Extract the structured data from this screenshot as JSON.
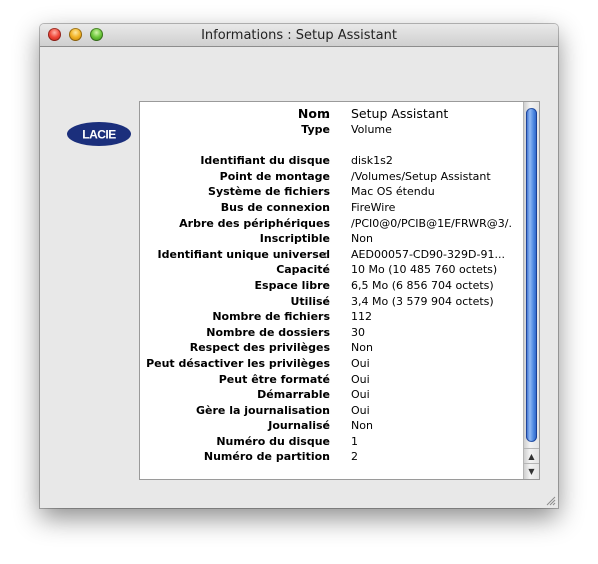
{
  "window": {
    "title": "Informations : Setup Assistant"
  },
  "logo": {
    "text": "LACIE",
    "color": "#1b2f7c"
  },
  "info": {
    "colon": ":",
    "rows": [
      {
        "label": "Nom",
        "value": "Setup Assistant"
      },
      {
        "label": "Type",
        "value": "Volume"
      },
      {
        "label": "Identifiant du disque",
        "value": "disk1s2"
      },
      {
        "label": "Point de montage",
        "value": "/Volumes/Setup Assistant"
      },
      {
        "label": "Système de fichiers",
        "value": "Mac OS étendu"
      },
      {
        "label": "Bus de connexion",
        "value": "FireWire"
      },
      {
        "label": "Arbre des périphériques",
        "value": "/PCI0@0/PCIB@1E/FRWR@3/..."
      },
      {
        "label": "Inscriptible",
        "value": "Non"
      },
      {
        "label": "Identifiant unique universel",
        "value": "AED00057-CD90-329D-91..."
      },
      {
        "label": "Capacité",
        "value": "10 Mo (10 485 760 octets)"
      },
      {
        "label": "Espace libre",
        "value": "6,5 Mo (6 856 704 octets)"
      },
      {
        "label": "Utilisé",
        "value": "3,4 Mo (3 579 904 octets)"
      },
      {
        "label": "Nombre de fichiers",
        "value": "112"
      },
      {
        "label": "Nombre de dossiers",
        "value": "30"
      },
      {
        "label": "Respect des privilèges",
        "value": "Non"
      },
      {
        "label": "Peut désactiver les privilèges",
        "value": "Oui"
      },
      {
        "label": "Peut être formaté",
        "value": "Oui"
      },
      {
        "label": "Démarrable",
        "value": "Oui"
      },
      {
        "label": "Gère la journalisation",
        "value": "Oui"
      },
      {
        "label": "Journalisé",
        "value": "Non"
      },
      {
        "label": "Numéro du disque",
        "value": "1"
      },
      {
        "label": "Numéro de partition",
        "value": "2"
      }
    ]
  },
  "scrollbar": {
    "up_glyph": "▲",
    "down_glyph": "▼"
  }
}
